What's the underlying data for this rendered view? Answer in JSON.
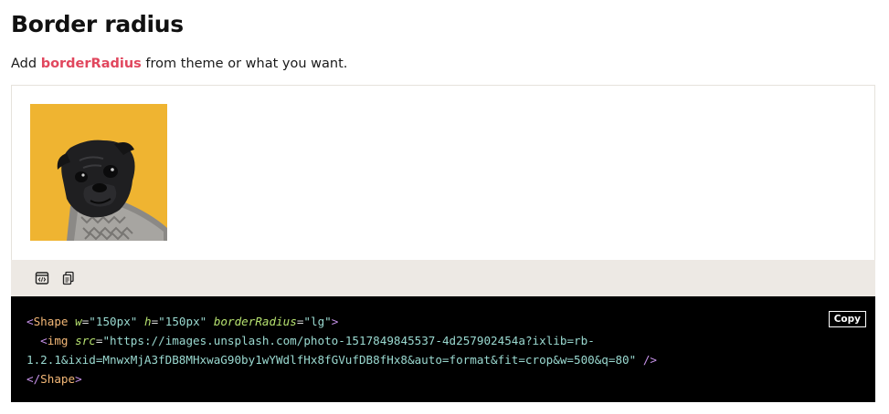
{
  "heading": "Border radius",
  "description": {
    "prefix": "Add ",
    "highlight": "borderRadius",
    "suffix": " from theme or what you want."
  },
  "demo": {
    "shape_background": "#efb431",
    "image_subject": "pug-dog-photo"
  },
  "toolbar": {
    "icons": [
      "code-editor-icon",
      "copy-document-icon"
    ]
  },
  "code": {
    "copy_label": "Copy",
    "line1": {
      "open": "<",
      "tag": "Shape",
      "attr_w": "w",
      "eq1": "=",
      "val_w": "\"150px\"",
      "attr_h": "h",
      "eq2": "=",
      "val_h": "\"150px\"",
      "attr_br": "borderRadius",
      "eq3": "=",
      "val_br": "\"lg\"",
      "close": ">"
    },
    "line2": {
      "open": "<",
      "tag": "img",
      "attr_src": "src",
      "eq": "=",
      "val_src_part1": "\"https://images.unsplash.com/photo-1517849845537-4d257902454a?ixlib=rb-",
      "val_src_part2": "1.2.1&ixid=MnwxMjA3fDB8MHxwaG90by1wYWdlfHx8fGVufDB8fHx8&auto=format&fit=crop&w=500&q=80\"",
      "self_close": "/>"
    },
    "line3": {
      "open": "</",
      "tag": "Shape",
      "close": ">"
    }
  },
  "colors": {
    "highlight": "#e1475e",
    "toolbar_bg": "#ede9e4",
    "code_bg": "#000000"
  }
}
